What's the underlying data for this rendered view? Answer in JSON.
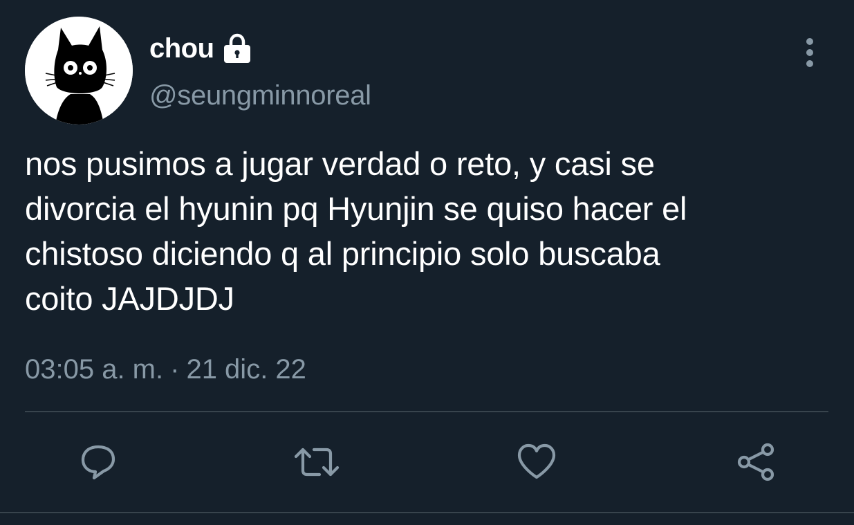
{
  "tweet": {
    "display_name": "chou",
    "username": "@seungminnoreal",
    "protected_icon": "lock-icon",
    "text": "nos pusimos a jugar verdad o reto, y casi se\ndivorcia el hyunin pq Hyunjin se quiso hacer el\nchistoso diciendo q al principio solo buscaba\ncoito JAJDJDJ",
    "time": "03:05 a. m.",
    "separator": "·",
    "date": "21 dic. 22"
  },
  "actions": [
    {
      "name": "reply",
      "icon": "reply-icon"
    },
    {
      "name": "retweet",
      "icon": "retweet-icon"
    },
    {
      "name": "like",
      "icon": "heart-icon"
    },
    {
      "name": "share",
      "icon": "share-icon"
    }
  ],
  "colors": {
    "background": "#15202b",
    "primary_text": "#ffffff",
    "secondary_text": "#8899a6",
    "divider": "#38444d"
  }
}
